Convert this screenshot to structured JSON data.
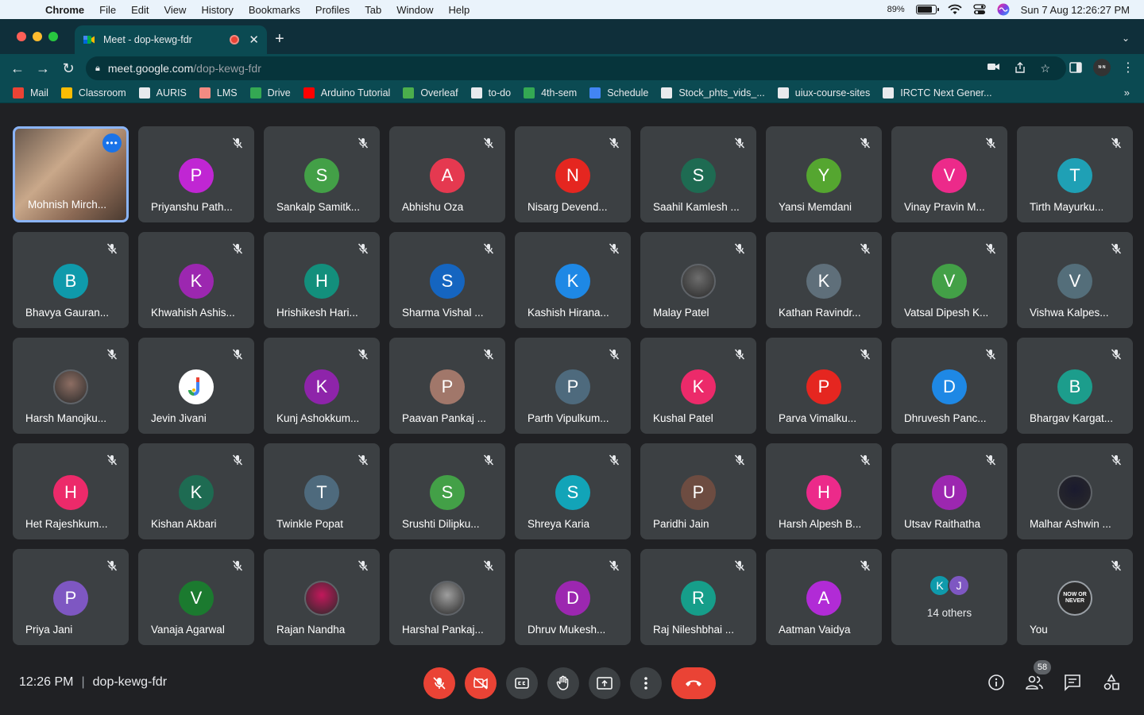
{
  "menubar": {
    "items": [
      "Chrome",
      "File",
      "Edit",
      "View",
      "History",
      "Bookmarks",
      "Profiles",
      "Tab",
      "Window",
      "Help"
    ],
    "battery_pct": "89%",
    "battery_level": 0.89,
    "datetime": "Sun 7 Aug  12:26:27 PM"
  },
  "browser": {
    "tab_title": "Meet - dop-kewg-fdr",
    "url_host": "meet.google.com",
    "url_path": "/dop-kewg-fdr",
    "bookmarks": [
      {
        "label": "Mail",
        "color": "#ea4335"
      },
      {
        "label": "Classroom",
        "color": "#fbbc04"
      },
      {
        "label": "AURIS",
        "color": "#e8eaed"
      },
      {
        "label": "LMS",
        "color": "#f28b82"
      },
      {
        "label": "Drive",
        "color": "#34a853"
      },
      {
        "label": "Arduino Tutorial",
        "color": "#ff0000"
      },
      {
        "label": "Overleaf",
        "color": "#4cae4c"
      },
      {
        "label": "to-do",
        "color": "#e8eaed"
      },
      {
        "label": "4th-sem",
        "color": "#34a853"
      },
      {
        "label": "Schedule",
        "color": "#4285f4"
      },
      {
        "label": "Stock_phts_vids_...",
        "color": "#e8eaed"
      },
      {
        "label": "uiux-course-sites",
        "color": "#e8eaed"
      },
      {
        "label": "IRCTC Next Gener...",
        "color": "#e8eaed"
      }
    ]
  },
  "participants": [
    {
      "name": "Mohnish Mirch...",
      "initial": "",
      "color": "",
      "self_video": true
    },
    {
      "name": "Priyanshu Path...",
      "initial": "P",
      "color": "#c026d3"
    },
    {
      "name": "Sankalp Samitk...",
      "initial": "S",
      "color": "#43a047"
    },
    {
      "name": "Abhishu Oza",
      "initial": "A",
      "color": "#e53950"
    },
    {
      "name": "Nisarg Devend...",
      "initial": "N",
      "color": "#e52620"
    },
    {
      "name": "Saahil Kamlesh ...",
      "initial": "S",
      "color": "#1e6b52"
    },
    {
      "name": "Yansi Memdani",
      "initial": "Y",
      "color": "#55a630"
    },
    {
      "name": "Vinay Pravin M...",
      "initial": "V",
      "color": "#ec2a8a"
    },
    {
      "name": "Tirth Mayurku...",
      "initial": "T",
      "color": "#1fa0b5"
    },
    {
      "name": "Bhavya Gauran...",
      "initial": "B",
      "color": "#0f9aab"
    },
    {
      "name": "Khwahish Ashis...",
      "initial": "K",
      "color": "#9c27b0"
    },
    {
      "name": "Hrishikesh Hari...",
      "initial": "H",
      "color": "#138f7c"
    },
    {
      "name": "Sharma Vishal ...",
      "initial": "S",
      "color": "#1565c0"
    },
    {
      "name": "Kashish Hirana...",
      "initial": "K",
      "color": "#1e88e5"
    },
    {
      "name": "Malay Patel",
      "initial": "",
      "color": "#6d6d6d",
      "photo": true
    },
    {
      "name": "Kathan Ravindr...",
      "initial": "K",
      "color": "#5f6f7a"
    },
    {
      "name": "Vatsal Dipesh K...",
      "initial": "V",
      "color": "#43a047"
    },
    {
      "name": "Vishwa Kalpes...",
      "initial": "V",
      "color": "#546e7a"
    },
    {
      "name": "Harsh Manojku...",
      "initial": "",
      "color": "#8d6e63",
      "photo": true
    },
    {
      "name": "Jevin Jivani",
      "initial": "J",
      "color": "#ffffff",
      "google": true
    },
    {
      "name": "Kunj Ashokkum...",
      "initial": "K",
      "color": "#8e24aa"
    },
    {
      "name": "Paavan Pankaj ...",
      "initial": "P",
      "color": "#a1776a"
    },
    {
      "name": "Parth Vipulkum...",
      "initial": "P",
      "color": "#4e6a7d"
    },
    {
      "name": "Kushal Patel",
      "initial": "K",
      "color": "#ec2a6a"
    },
    {
      "name": "Parva Vimalku...",
      "initial": "P",
      "color": "#e52620"
    },
    {
      "name": "Dhruvesh Panc...",
      "initial": "D",
      "color": "#1e88e5"
    },
    {
      "name": "Bhargav Kargat...",
      "initial": "B",
      "color": "#1c9d8c"
    },
    {
      "name": "Het Rajeshkum...",
      "initial": "H",
      "color": "#ec2a6a"
    },
    {
      "name": "Kishan Akbari",
      "initial": "K",
      "color": "#1e6b52"
    },
    {
      "name": "Twinkle Popat",
      "initial": "T",
      "color": "#4e6a7d"
    },
    {
      "name": "Srushti Dilipku...",
      "initial": "S",
      "color": "#43a047"
    },
    {
      "name": "Shreya Karia",
      "initial": "S",
      "color": "#12a4b8"
    },
    {
      "name": "Paridhi Jain",
      "initial": "P",
      "color": "#6d4c41"
    },
    {
      "name": "Harsh Alpesh B...",
      "initial": "H",
      "color": "#ec2a8a"
    },
    {
      "name": "Utsav Raithatha",
      "initial": "U",
      "color": "#9c27b0"
    },
    {
      "name": "Malhar Ashwin ...",
      "initial": "",
      "color": "#1a1a2e",
      "photo": true
    },
    {
      "name": "Priya Jani",
      "initial": "P",
      "color": "#7e57c2"
    },
    {
      "name": "Vanaja Agarwal",
      "initial": "V",
      "color": "#1b7a2f"
    },
    {
      "name": "Rajan Nandha",
      "initial": "",
      "color": "#c2185b",
      "photo": true
    },
    {
      "name": "Harshal Pankaj...",
      "initial": "",
      "color": "#9e9e9e",
      "photo": true
    },
    {
      "name": "Dhruv Mukesh...",
      "initial": "D",
      "color": "#9c27b0"
    },
    {
      "name": "Raj Nileshbhai ...",
      "initial": "R",
      "color": "#169e8a"
    },
    {
      "name": "Aatman Vaidya",
      "initial": "A",
      "color": "#b12bd6"
    },
    {
      "name": "",
      "others": true
    },
    {
      "name": "You",
      "initial": "",
      "color": "#2b2b2b",
      "you": true
    }
  ],
  "others_tile": {
    "label": "14 others",
    "avatars": [
      {
        "initial": "K",
        "color": "#0f9aab"
      },
      {
        "initial": "J",
        "color": "#7e57c2"
      }
    ]
  },
  "you_avatar_text": "NOW OR NEVER",
  "meeting": {
    "time": "12:26 PM",
    "code": "dop-kewg-fdr",
    "people_count": "58"
  },
  "colors": {
    "accent_red": "#ea4335",
    "tile_bg": "#3c4043",
    "page_bg": "#202124"
  }
}
